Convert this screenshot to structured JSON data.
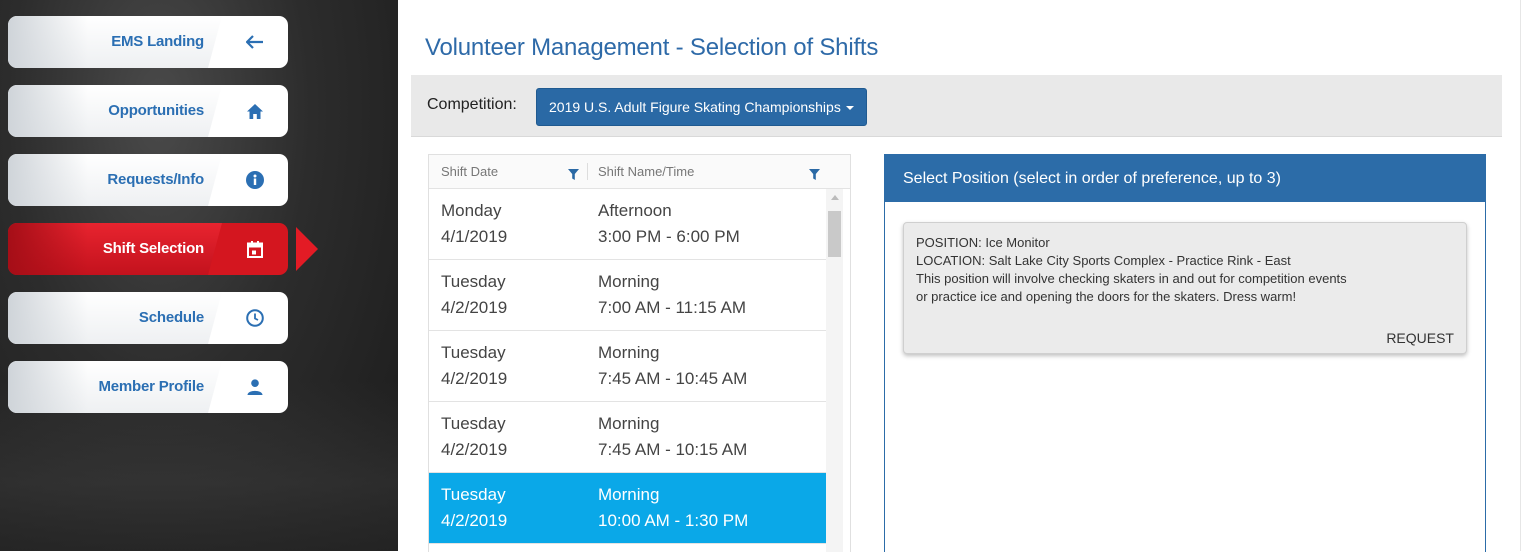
{
  "sidebar": {
    "items": [
      {
        "label": "EMS Landing",
        "icon": "arrow-left-icon"
      },
      {
        "label": "Opportunities",
        "icon": "home-icon"
      },
      {
        "label": "Requests/Info",
        "icon": "info-icon"
      },
      {
        "label": "Shift Selection",
        "icon": "calendar-icon",
        "active": true
      },
      {
        "label": "Schedule",
        "icon": "clock-icon"
      },
      {
        "label": "Member Profile",
        "icon": "user-icon"
      }
    ]
  },
  "main": {
    "title": "Volunteer Management - Selection of Shifts",
    "competition": {
      "label": "Competition:",
      "selected": "2019 U.S. Adult Figure Skating Championships"
    }
  },
  "shift_grid": {
    "columns": [
      "Shift Date",
      "Shift Name/Time"
    ],
    "rows": [
      {
        "day": "Monday",
        "date": "4/1/2019",
        "name": "Afternoon",
        "time": "3:00 PM - 6:00 PM",
        "selected": false
      },
      {
        "day": "Tuesday",
        "date": "4/2/2019",
        "name": "Morning",
        "time": "7:00 AM - 11:15 AM",
        "selected": false
      },
      {
        "day": "Tuesday",
        "date": "4/2/2019",
        "name": "Morning",
        "time": "7:45 AM - 10:45 AM",
        "selected": false
      },
      {
        "day": "Tuesday",
        "date": "4/2/2019",
        "name": "Morning",
        "time": "7:45 AM - 10:15 AM",
        "selected": false
      },
      {
        "day": "Tuesday",
        "date": "4/2/2019",
        "name": "Morning",
        "time": "10:00 AM - 1:30 PM",
        "selected": true
      }
    ]
  },
  "position_panel": {
    "header": "Select Position (select in order of preference, up to 3)",
    "card": {
      "position": "POSITION: Ice Monitor",
      "location": "LOCATION: Salt Lake City Sports Complex - Practice Rink - East",
      "description_line1": "This position will involve checking skaters in and out for competition events",
      "description_line2": "or practice ice and opening the doors for the skaters. Dress warm!",
      "action": "REQUEST"
    }
  },
  "colors": {
    "brand_blue": "#2c6ca8",
    "active_red": "#d4161f",
    "selected_row": "#0aa8e8"
  }
}
